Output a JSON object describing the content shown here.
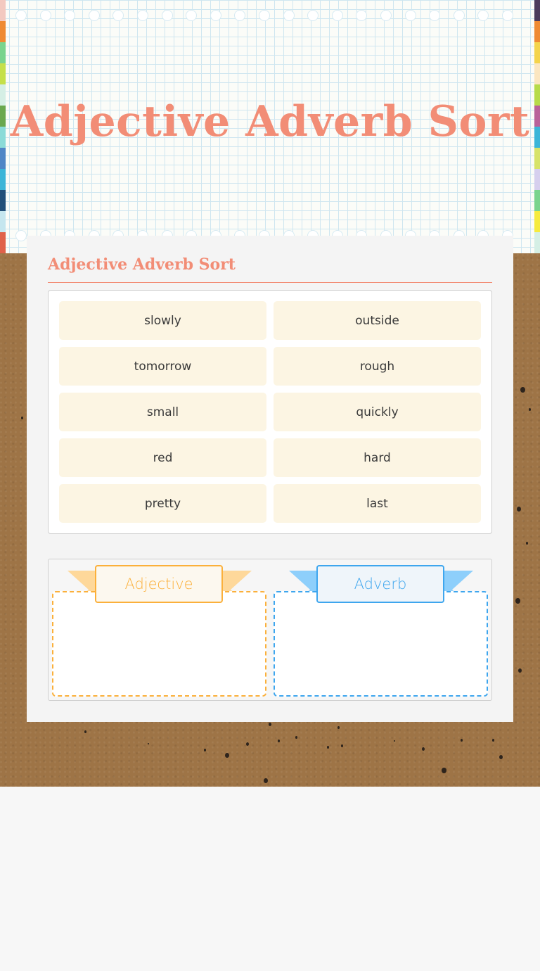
{
  "header": {
    "title": "Adjective Adverb Sort"
  },
  "activity": {
    "title": "Adjective Adverb Sort",
    "words": [
      "slowly",
      "outside",
      "tomorrow",
      "rough",
      "small",
      "quickly",
      "red",
      "hard",
      "pretty",
      "last"
    ],
    "categories": [
      {
        "label": "Adjective",
        "color": "#fbb03b"
      },
      {
        "label": "Adverb",
        "color": "#3ea6ee"
      }
    ]
  },
  "colors": {
    "title": "#f28d76",
    "word_tile": "#fcf5e3",
    "cardboard": "#9e7446"
  }
}
